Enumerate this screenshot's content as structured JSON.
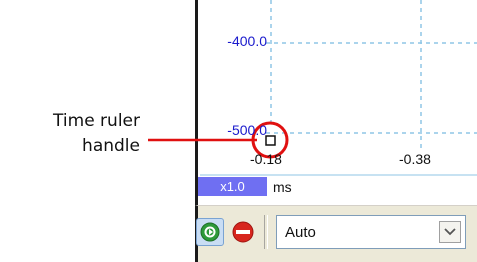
{
  "callout": {
    "line1": "Time ruler",
    "line2": "handle"
  },
  "scope": {
    "y_ticks": [
      "-400.0",
      "-500.0"
    ],
    "x_ticks": [
      "-0.18",
      "-0.38"
    ],
    "axis_color": "#1a1acc",
    "grid_color": "#8fc6e6",
    "multiplier": "x1.0",
    "multiplier_color": "#6f6ff2",
    "unit": "ms"
  },
  "annotation": {
    "circle_color": "#e01010",
    "arrow_color": "#e01010"
  },
  "toolbar": {
    "go_icon": "go-icon",
    "stop_icon": "stop-icon",
    "select_value": "Auto"
  }
}
